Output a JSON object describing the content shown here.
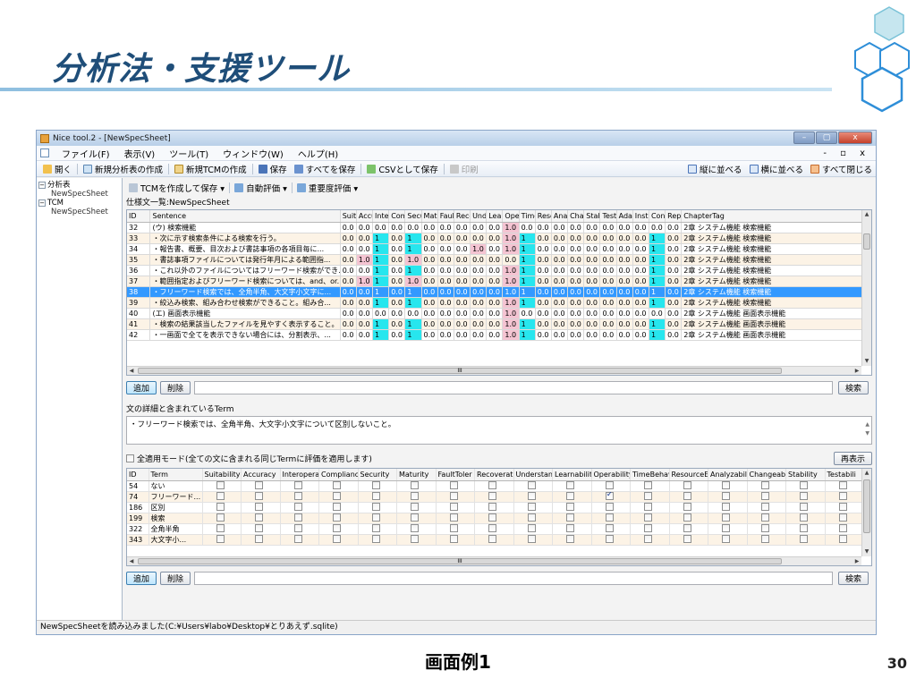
{
  "slide": {
    "title": "分析法・支援ツール",
    "caption": "画面例1",
    "page_number": "30",
    "accent_color": "#1f4e79",
    "hex_color": "#2e8ed8"
  },
  "window": {
    "title": "Nice tool.2 - [NewSpecSheet]",
    "controls": [
      "–",
      "▢",
      "x"
    ]
  },
  "menu": {
    "items": [
      "ファイル(F)",
      "表示(V)",
      "ツール(T)",
      "ウィンドウ(W)",
      "ヘルプ(H)"
    ],
    "right_controls": "- ▫ x"
  },
  "toolbar": {
    "open": "開く",
    "new_analysis": "新規分析表の作成",
    "new_tcm": "新規TCMの作成",
    "save": "保存",
    "save_all": "すべてを保存",
    "save_csv": "CSVとして保存",
    "print": "印刷",
    "tile_vertical": "縦に並べる",
    "tile_horizontal": "横に並べる",
    "close_all": "すべて閉じる"
  },
  "tree": {
    "root1": "分析表",
    "root1_child": "NewSpecSheet",
    "root2": "TCM",
    "root2_child": "NewSpecSheet"
  },
  "subtoolbar": {
    "create_tcm": "TCMを作成して保存 ▾",
    "auto_eval": "自動評価 ▾",
    "importance_eval": "重要度評価 ▾"
  },
  "spec_list_label": "仕様文一覧:NewSpecSheet",
  "spec_grid": {
    "headers": [
      "ID",
      "Sentence",
      "Suit",
      "Accu",
      "Inter",
      "Com",
      "Secu",
      "Matu",
      "Faul",
      "Reco",
      "Undr",
      "Lear",
      "Oper",
      "Time",
      "Reso",
      "Anal",
      "Char",
      "Stab",
      "Test",
      "Adap",
      "Insta",
      "Cont",
      "Repl",
      "ChapterTag"
    ],
    "rows": [
      {
        "id": "32",
        "sentence": "(ウ) 検索機能",
        "vals": [
          "0.0",
          "0.0",
          "0.0",
          "0.0",
          "0.0",
          "0.0",
          "0.0",
          "0.0",
          "0.0",
          "0.0",
          "1.0",
          "0.0",
          "0.0",
          "0.0",
          "0.0",
          "0.0",
          "0.0",
          "0.0",
          "0.0",
          "0.0",
          "0.0"
        ],
        "tag": "2章 システム機能 検索機能"
      },
      {
        "id": "33",
        "sentence": "・次に示す検索条件による検索を行う。",
        "vals": [
          "0.0",
          "0.0",
          "1",
          "0.0",
          "1",
          "0.0",
          "0.0",
          "0.0",
          "0.0",
          "0.0",
          "1.0",
          "1",
          "0.0",
          "0.0",
          "0.0",
          "0.0",
          "0.0",
          "0.0",
          "0.0",
          "1",
          "0.0"
        ],
        "tag": "2章 システム機能 検索機能"
      },
      {
        "id": "34",
        "sentence": "・報告書、概要、目次および書誌事項の各項目毎に...",
        "vals": [
          "0.0",
          "0.0",
          "1",
          "0.0",
          "1",
          "0.0",
          "0.0",
          "0.0",
          "1.0",
          "0.0",
          "1.0",
          "1",
          "0.0",
          "0.0",
          "0.0",
          "0.0",
          "0.0",
          "0.0",
          "0.0",
          "1",
          "0.0"
        ],
        "tag": "2章 システム機能 検索機能"
      },
      {
        "id": "35",
        "sentence": "・書誌事項ファイルについては発行年月による範囲指...",
        "vals": [
          "0.0",
          "1.0",
          "1",
          "0.0",
          "1.0",
          "0.0",
          "0.0",
          "0.0",
          "0.0",
          "0.0",
          "0.0",
          "1",
          "0.0",
          "0.0",
          "0.0",
          "0.0",
          "0.0",
          "0.0",
          "0.0",
          "1",
          "0.0"
        ],
        "tag": "2章 システム機能 検索機能"
      },
      {
        "id": "36",
        "sentence": "・これ以外のファイルについてはフリーワード検索ができ...",
        "vals": [
          "0.0",
          "0.0",
          "1",
          "0.0",
          "1",
          "0.0",
          "0.0",
          "0.0",
          "0.0",
          "0.0",
          "1.0",
          "1",
          "0.0",
          "0.0",
          "0.0",
          "0.0",
          "0.0",
          "0.0",
          "0.0",
          "1",
          "0.0"
        ],
        "tag": "2章 システム機能 検索機能"
      },
      {
        "id": "37",
        "sentence": "・範囲指定およびフリーワード検索については、and、or...",
        "vals": [
          "0.0",
          "1.0",
          "1",
          "0.0",
          "1.0",
          "0.0",
          "0.0",
          "0.0",
          "0.0",
          "0.0",
          "1.0",
          "1",
          "0.0",
          "0.0",
          "0.0",
          "0.0",
          "0.0",
          "0.0",
          "0.0",
          "1",
          "0.0"
        ],
        "tag": "2章 システム機能 検索機能"
      },
      {
        "id": "38",
        "sentence": "・フリーワード検索では、全角半角、大文字小文字に...",
        "vals": [
          "0.0",
          "0.0",
          "1",
          "0.0",
          "1",
          "0.0",
          "0.0",
          "0.0",
          "0.0",
          "0.0",
          "1.0",
          "1",
          "0.0",
          "0.0",
          "0.0",
          "0.0",
          "0.0",
          "0.0",
          "0.0",
          "1",
          "0.0"
        ],
        "tag": "2章 システム機能 検索機能"
      },
      {
        "id": "39",
        "sentence": "・絞込み検索、組み合わせ検索ができること。組み合...",
        "vals": [
          "0.0",
          "0.0",
          "1",
          "0.0",
          "1",
          "0.0",
          "0.0",
          "0.0",
          "0.0",
          "0.0",
          "1.0",
          "1",
          "0.0",
          "0.0",
          "0.0",
          "0.0",
          "0.0",
          "0.0",
          "0.0",
          "1",
          "0.0"
        ],
        "tag": "2章 システム機能 検索機能"
      },
      {
        "id": "40",
        "sentence": "(エ) 画面表示機能",
        "vals": [
          "0.0",
          "0.0",
          "0.0",
          "0.0",
          "0.0",
          "0.0",
          "0.0",
          "0.0",
          "0.0",
          "0.0",
          "1.0",
          "0.0",
          "0.0",
          "0.0",
          "0.0",
          "0.0",
          "0.0",
          "0.0",
          "0.0",
          "0.0",
          "0.0"
        ],
        "tag": "2章 システム機能 画面表示機能"
      },
      {
        "id": "41",
        "sentence": "・検索の結果該当したファイルを見やすく表示すること。",
        "vals": [
          "0.0",
          "0.0",
          "1",
          "0.0",
          "1",
          "0.0",
          "0.0",
          "0.0",
          "0.0",
          "0.0",
          "1.0",
          "1",
          "0.0",
          "0.0",
          "0.0",
          "0.0",
          "0.0",
          "0.0",
          "0.0",
          "1",
          "0.0"
        ],
        "tag": "2章 システム機能 画面表示機能"
      },
      {
        "id": "42",
        "sentence": "・一画面で全てを表示できない場合には、分割表示、...",
        "vals": [
          "0.0",
          "0.0",
          "1",
          "0.0",
          "1",
          "0.0",
          "0.0",
          "0.0",
          "0.0",
          "0.0",
          "1.0",
          "1",
          "0.0",
          "0.0",
          "0.0",
          "0.0",
          "0.0",
          "0.0",
          "0.0",
          "1",
          "0.0"
        ],
        "tag": "2章 システム機能 画面表示機能"
      }
    ],
    "selected_id": "38",
    "hscroll_label": "III"
  },
  "buttons1": {
    "add": "追加",
    "delete": "削除",
    "search": "検索"
  },
  "term_label": "文の詳細と含まれているTerm",
  "detail_text": "・フリーワード検索では、全角半角、大文字小文字について区別しないこと。",
  "apply_mode_label": "全適用モード(全ての文に含まれる同じTermに評価を適用します)",
  "redisplay": "再表示",
  "term_grid": {
    "headers": [
      "ID",
      "Term",
      "Suitability",
      "Accuracy",
      "Interoperal",
      "Complianc",
      "Security",
      "Maturity",
      "FaultToler",
      "Recoverat",
      "Understan",
      "Learnabilit",
      "Operability",
      "TimeBehav",
      "ResourceE",
      "Analyzabil",
      "Changeabi",
      "Stability",
      "Testabili"
    ],
    "rows": [
      {
        "id": "54",
        "term": "ない",
        "checked": []
      },
      {
        "id": "74",
        "term": "フリーワード...",
        "checked": [
          10
        ]
      },
      {
        "id": "186",
        "term": "区別",
        "checked": []
      },
      {
        "id": "199",
        "term": "検索",
        "checked": []
      },
      {
        "id": "322",
        "term": "全角半角",
        "checked": []
      },
      {
        "id": "343",
        "term": "大文字小...",
        "checked": []
      }
    ],
    "hscroll_label": "III"
  },
  "buttons2": {
    "add": "追加",
    "delete": "削除",
    "search": "検索"
  },
  "status": "NewSpecSheetを読み込みました(C:¥Users¥labo¥Desktop¥とりあえず.sqlite)"
}
